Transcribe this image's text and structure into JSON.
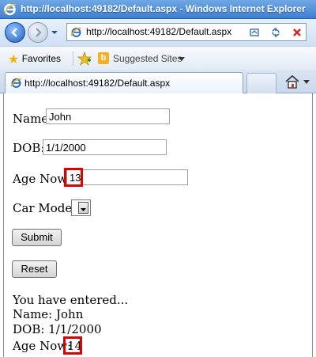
{
  "window": {
    "title": "http://localhost:49182/Default.aspx - Windows Internet Explorer"
  },
  "addressbar": {
    "url": "http://localhost:49182/Default.aspx"
  },
  "favorites": {
    "label": "Favorites",
    "suggested_sites": "Suggested Sites",
    "bing_letter": "b"
  },
  "tabs": [
    {
      "label": "http://localhost:49182/Default.aspx"
    }
  ],
  "form": {
    "name_label": "Name:",
    "name_value": "John",
    "dob_label": "DOB:",
    "dob_value": "1/1/2000",
    "age_label": "Age Now:",
    "age_value": "13",
    "car_model_label": "Car Model:",
    "submit_label": "Submit",
    "reset_label": "Reset"
  },
  "result": {
    "heading": "You have entered...",
    "name_line": "Name: John",
    "dob_line": "DOB: 1/1/2000",
    "age_label": "Age Now:",
    "age_value": "14"
  },
  "colors": {
    "highlight": "#e00000",
    "titlebar": "#3d7fd1"
  }
}
